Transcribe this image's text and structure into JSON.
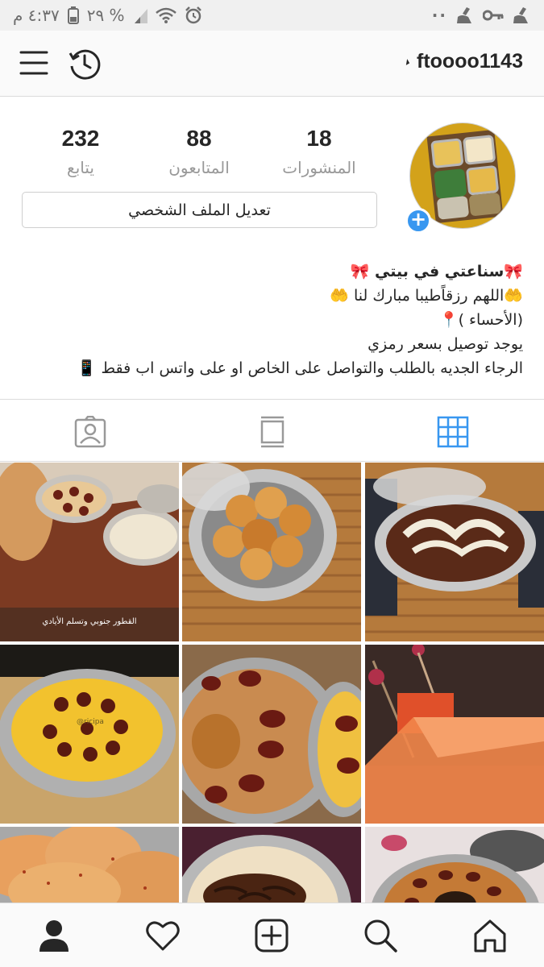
{
  "status_bar": {
    "time": "٤:٣٧ م",
    "battery": "٢٩ %",
    "left_icons": [
      "alarm-icon",
      "wifi-icon",
      "signal-icon",
      "battery-icon"
    ],
    "right_icons": [
      "cleaner-icon",
      "key-icon",
      "cleaner-icon",
      "dots-icon"
    ],
    "dots": "··"
  },
  "header": {
    "username": "ftoooo1143",
    "icons": [
      "menu-icon",
      "history-icon",
      "caret-icon"
    ]
  },
  "profile": {
    "stats": [
      {
        "key": "posts",
        "value": "18",
        "label": "المنشورات"
      },
      {
        "key": "followers",
        "value": "88",
        "label": "المتابعون"
      },
      {
        "key": "following",
        "value": "232",
        "label": "يتابع"
      }
    ],
    "edit_label": "تعديل الملف الشخصي",
    "add_badge": "+"
  },
  "bio": {
    "lines": [
      "🎀سناعتي في بيتي 🎀",
      "🤲اللهم رزقاًطيبا مبارك لنا 🤲",
      "(الأحساء )📍",
      "يوجد توصيل بسعر رمزي",
      "الرجاء الجديه بالطلب والتواصل على الخاص او على واتس اب فقط 📱"
    ]
  },
  "tabs": {
    "items": [
      "grid-icon",
      "igtv-icon",
      "tagged-icon"
    ],
    "active": "grid",
    "active_color": "#3897f0"
  },
  "posts": {
    "captions": [
      "القطور جنوبي وتسلم الأيادي",
      "@ricipa"
    ],
    "tiles": [
      {
        "name": "post-sweets-tray"
      },
      {
        "name": "post-pastries-pot"
      },
      {
        "name": "post-dessert-pot"
      },
      {
        "name": "post-custard-dates"
      },
      {
        "name": "post-date-pudding"
      },
      {
        "name": "post-orange-gift"
      },
      {
        "name": "post-flatbread"
      },
      {
        "name": "post-onion-rice"
      },
      {
        "name": "post-date-cake"
      }
    ]
  },
  "bottom_nav": {
    "items": [
      "profile-icon",
      "heart-icon",
      "add-icon",
      "search-icon",
      "home-icon"
    ]
  }
}
